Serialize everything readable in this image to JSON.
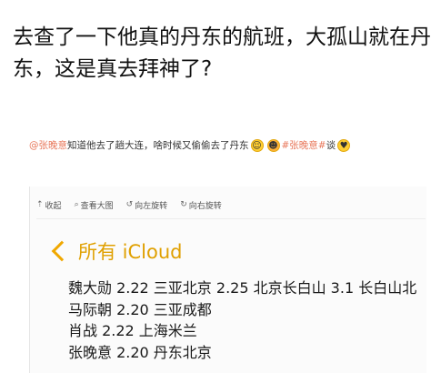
{
  "post": {
    "headline": "去查了一下他真的丹东的航班，大孤山就在丹东，这是真去拜神了?"
  },
  "caption": {
    "mention": "@张晚意",
    "text": "知道他去了趟大连，啥时候又偷偷去了丹东",
    "hashtag": "#张晚意#",
    "trail": "谈",
    "emoji_icons": [
      "smile-emoji-icon",
      "grin-emoji-icon",
      "heart-eyes-emoji-icon"
    ]
  },
  "toolbar": {
    "collapse_label": "收起",
    "view_large_label": "查看大图",
    "rotate_left_label": "向左旋转",
    "rotate_right_label": "向右旋转"
  },
  "screenshot": {
    "back_label": "所有 iCloud",
    "accent_color": "#e0a000",
    "notes": [
      "魏大勋 2.22 三亚北京 2.25 北京长白山 3.1 长白山北",
      "马际朝 2.20 三亚成都",
      "肖战 2.22 上海米兰",
      "张晚意 2.20 丹东北京"
    ]
  }
}
